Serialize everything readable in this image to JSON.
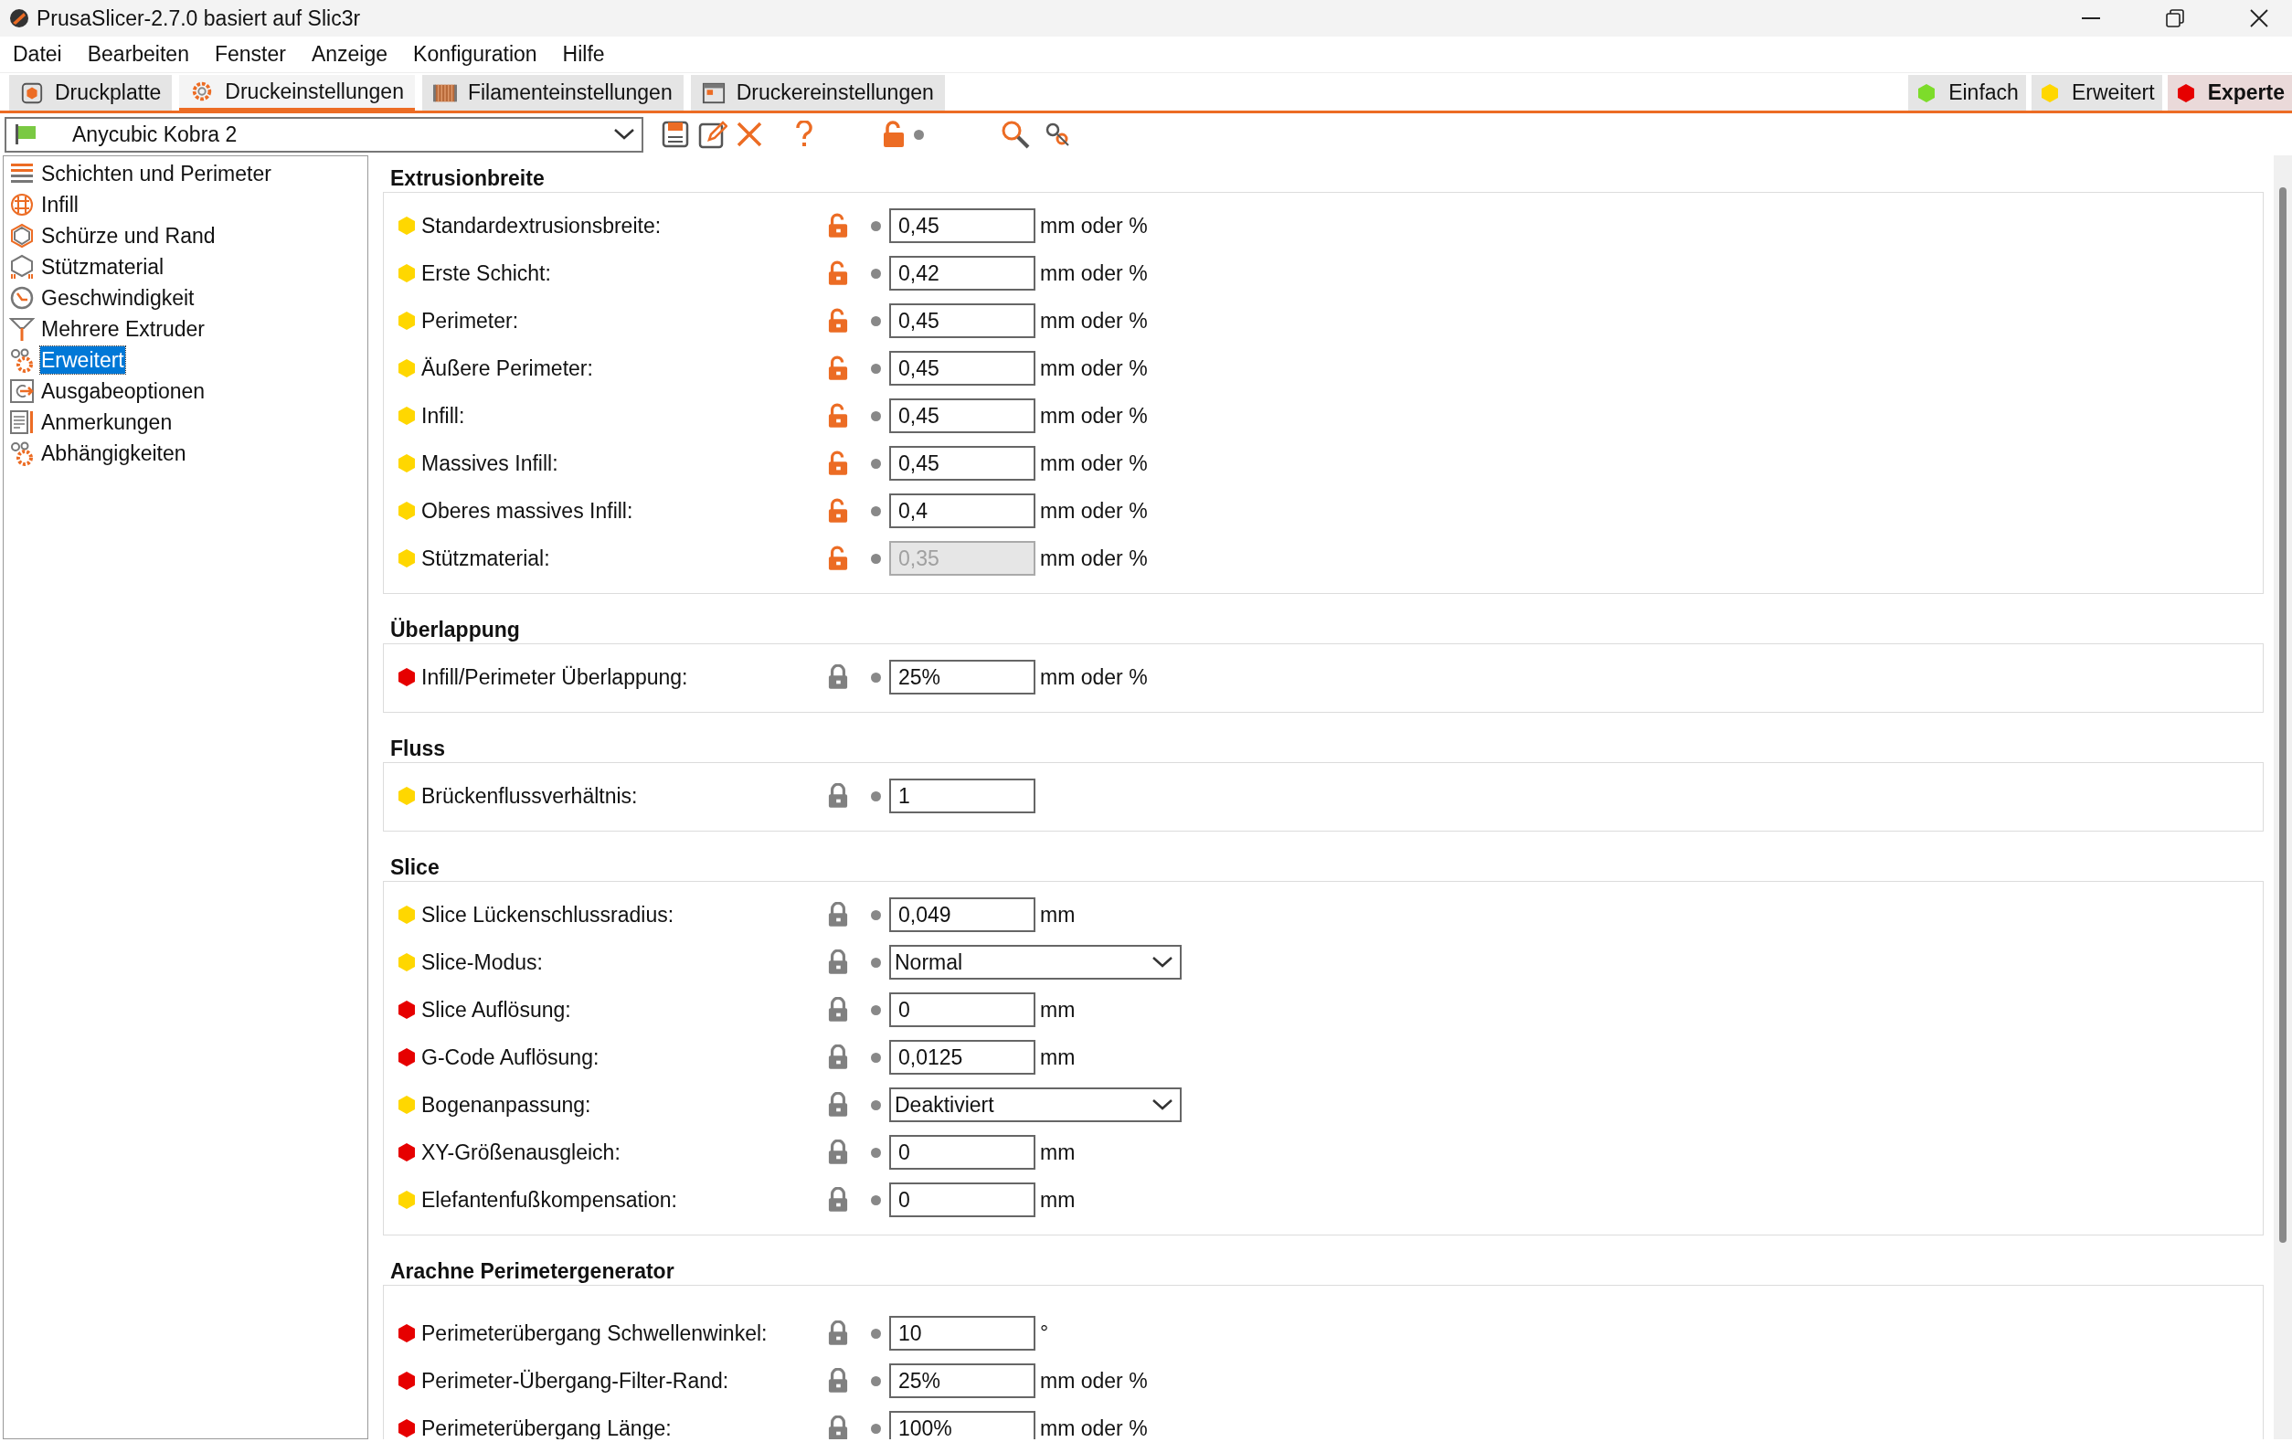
{
  "window": {
    "title": "PrusaSlicer-2.7.0 basiert auf Slic3r"
  },
  "menu": [
    "Datei",
    "Bearbeiten",
    "Fenster",
    "Anzeige",
    "Konfiguration",
    "Hilfe"
  ],
  "tabs": [
    {
      "label": "Druckplatte",
      "selected": false
    },
    {
      "label": "Druckeinstellungen",
      "selected": true
    },
    {
      "label": "Filamenteinstellungen",
      "selected": false
    },
    {
      "label": "Druckereinstellungen",
      "selected": false
    }
  ],
  "modes": [
    {
      "label": "Einfach",
      "color": "#7ddc2a",
      "selected": false
    },
    {
      "label": "Erweitert",
      "color": "#ffd700",
      "selected": false
    },
    {
      "label": "Experte",
      "color": "#e60000",
      "selected": true
    }
  ],
  "preset": {
    "value": "Anycubic Kobra 2"
  },
  "sidebar": {
    "items": [
      {
        "label": "Schichten und Perimeter",
        "selected": false
      },
      {
        "label": "Infill",
        "selected": false
      },
      {
        "label": "Schürze und Rand",
        "selected": false
      },
      {
        "label": "Stützmaterial",
        "selected": false
      },
      {
        "label": "Geschwindigkeit",
        "selected": false
      },
      {
        "label": "Mehrere Extruder",
        "selected": false
      },
      {
        "label": "Erweitert",
        "selected": true
      },
      {
        "label": "Ausgabeoptionen",
        "selected": false
      },
      {
        "label": "Anmerkungen",
        "selected": false
      },
      {
        "label": "Abhängigkeiten",
        "selected": false
      }
    ]
  },
  "groups": [
    {
      "title": "Extrusionbreite",
      "rows": [
        {
          "color": "#ffd700",
          "label": "Standardextrusionsbreite:",
          "locked": false,
          "kind": "text",
          "value": "0,45",
          "disabled": false,
          "unit": "mm oder %"
        },
        {
          "color": "#ffd700",
          "label": "Erste Schicht:",
          "locked": false,
          "kind": "text",
          "value": "0,42",
          "disabled": false,
          "unit": "mm oder %"
        },
        {
          "color": "#ffd700",
          "label": "Perimeter:",
          "locked": false,
          "kind": "text",
          "value": "0,45",
          "disabled": false,
          "unit": "mm oder %"
        },
        {
          "color": "#ffd700",
          "label": "Äußere Perimeter:",
          "locked": false,
          "kind": "text",
          "value": "0,45",
          "disabled": false,
          "unit": "mm oder %"
        },
        {
          "color": "#ffd700",
          "label": "Infill:",
          "locked": false,
          "kind": "text",
          "value": "0,45",
          "disabled": false,
          "unit": "mm oder %"
        },
        {
          "color": "#ffd700",
          "label": "Massives Infill:",
          "locked": false,
          "kind": "text",
          "value": "0,45",
          "disabled": false,
          "unit": "mm oder %"
        },
        {
          "color": "#ffd700",
          "label": "Oberes massives Infill:",
          "locked": false,
          "kind": "text",
          "value": "0,4",
          "disabled": false,
          "unit": "mm oder %"
        },
        {
          "color": "#ffd700",
          "label": "Stützmaterial:",
          "locked": false,
          "kind": "text",
          "value": "0,35",
          "disabled": true,
          "unit": "mm oder %"
        }
      ]
    },
    {
      "title": "Überlappung",
      "rows": [
        {
          "color": "#e60000",
          "label": "Infill/Perimeter Überlappung:",
          "locked": true,
          "kind": "text",
          "value": "25%",
          "disabled": false,
          "unit": "mm oder %"
        }
      ]
    },
    {
      "title": "Fluss",
      "rows": [
        {
          "color": "#ffd700",
          "label": "Brückenflussverhältnis:",
          "locked": true,
          "kind": "text",
          "value": "1",
          "disabled": false
        }
      ]
    },
    {
      "title": "Slice",
      "rows": [
        {
          "color": "#ffd700",
          "label": "Slice Lückenschlussradius:",
          "locked": true,
          "kind": "text",
          "value": "0,049",
          "disabled": false,
          "unit": "mm"
        },
        {
          "color": "#ffd700",
          "label": "Slice-Modus:",
          "locked": true,
          "kind": "select",
          "value": "Normal"
        },
        {
          "color": "#e60000",
          "label": "Slice Auflösung:",
          "locked": true,
          "kind": "text",
          "value": "0",
          "disabled": false,
          "unit": "mm"
        },
        {
          "color": "#e60000",
          "label": "G-Code Auflösung:",
          "locked": true,
          "kind": "text",
          "value": "0,0125",
          "disabled": false,
          "unit": "mm"
        },
        {
          "color": "#ffd700",
          "label": "Bogenanpassung:",
          "locked": true,
          "kind": "select",
          "value": "Deaktiviert"
        },
        {
          "color": "#e60000",
          "label": "XY-Größenausgleich:",
          "locked": true,
          "kind": "text",
          "value": "0",
          "disabled": false,
          "unit": "mm"
        },
        {
          "color": "#ffd700",
          "label": "Elefantenfußkompensation:",
          "locked": true,
          "kind": "text",
          "value": "0",
          "disabled": false,
          "unit": "mm"
        }
      ]
    },
    {
      "title": "Arachne Perimetergenerator",
      "rows": [
        {
          "color": "#e60000",
          "label": "Perimeterübergang Schwellenwinkel:",
          "locked": true,
          "kind": "text",
          "value": "10",
          "disabled": false,
          "unit": "°"
        },
        {
          "color": "#e60000",
          "label": "Perimeter-Übergang-Filter-Rand:",
          "locked": true,
          "kind": "text",
          "value": "25%",
          "disabled": false,
          "unit": "mm oder %"
        },
        {
          "color": "#e60000",
          "label": "Perimeterübergang Länge:",
          "locked": true,
          "kind": "text",
          "value": "100%",
          "disabled": false,
          "unit": "mm oder %"
        }
      ]
    }
  ]
}
